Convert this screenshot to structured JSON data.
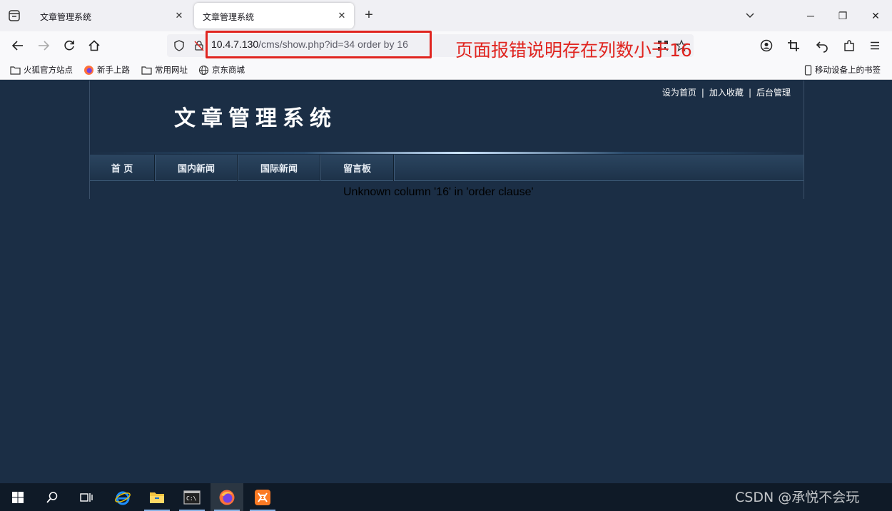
{
  "browser": {
    "tabs": [
      {
        "title": "文章管理系统",
        "close": "✕"
      },
      {
        "title": "文章管理系统",
        "close": "✕"
      }
    ],
    "new_tab": "+",
    "window_controls": {
      "minimize": "─",
      "maximize": "❐",
      "close": "✕"
    },
    "url": {
      "host": "10.4.7.130",
      "path": "/cms/show.php?id=34 order by 16"
    },
    "annotation": "页面报错说明存在列数小于16",
    "bookmarks": [
      {
        "label": "火狐官方站点",
        "icon": "folder-icon"
      },
      {
        "label": "新手上路",
        "icon": "firefox-icon"
      },
      {
        "label": "常用网址",
        "icon": "folder-icon"
      },
      {
        "label": "京东商城",
        "icon": "globe-icon"
      }
    ],
    "mobile_bookmarks": "移动设备上的书签"
  },
  "site": {
    "top_links": [
      "设为首页",
      "加入收藏",
      "后台管理"
    ],
    "separator": "|",
    "logo": "文章管理系统",
    "menu": [
      "首 页",
      "国内新闻",
      "国际新闻",
      "留言板"
    ],
    "error": "Unknown column '16' in 'order clause'"
  },
  "taskbar": {
    "watermark": "CSDN @承悦不会玩"
  },
  "colors": {
    "page_bg": "#1b2e45",
    "annotation": "#e0241f",
    "browser_chrome": "#f9f9fb"
  }
}
